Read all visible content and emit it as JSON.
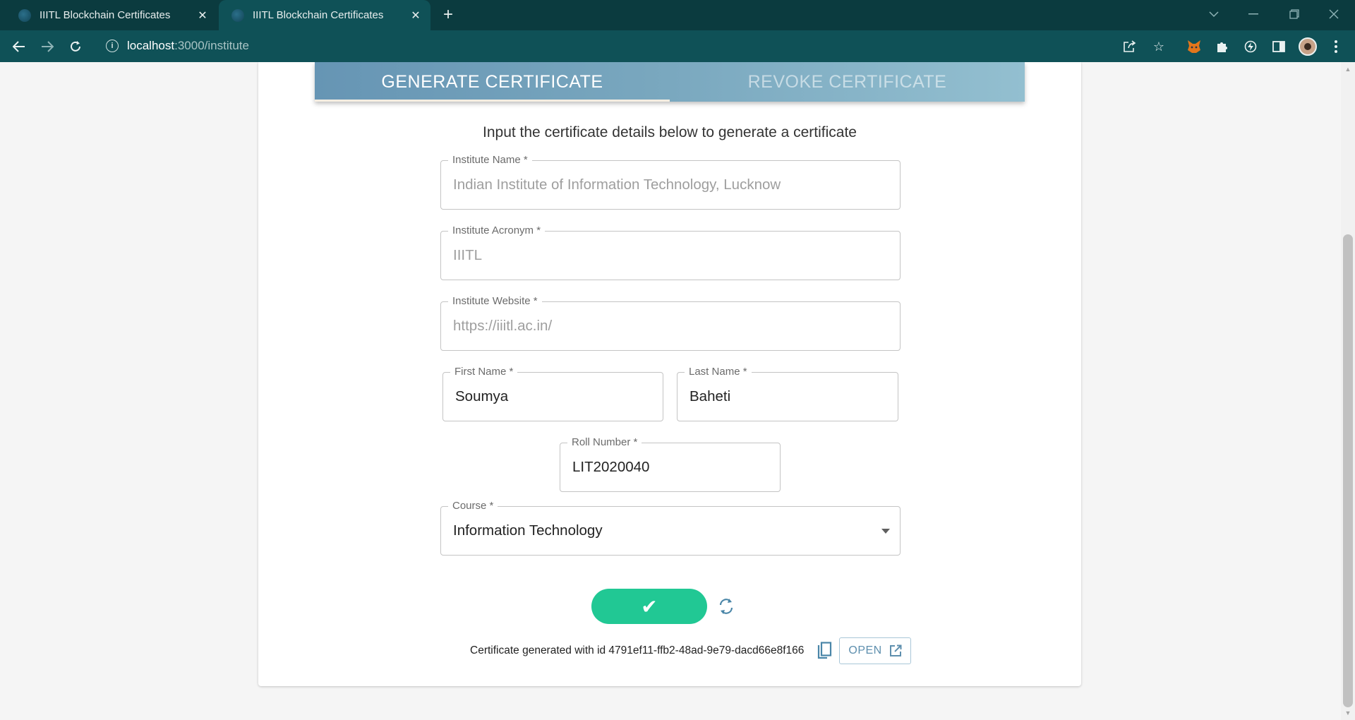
{
  "browser": {
    "tabs": [
      {
        "title": "IIITL Blockchain Certificates",
        "active": false
      },
      {
        "title": "IIITL Blockchain Certificates",
        "active": true
      }
    ],
    "url_host": "localhost",
    "url_path": ":3000/institute"
  },
  "page": {
    "tabs": {
      "generate": "GENERATE CERTIFICATE",
      "revoke": "REVOKE CERTIFICATE"
    },
    "subtitle": "Input the certificate details below to generate a certificate",
    "fields": {
      "institute_name": {
        "label": "Institute Name *",
        "value": "Indian Institute of Information Technology, Lucknow"
      },
      "institute_acronym": {
        "label": "Institute Acronym *",
        "value": "IIITL"
      },
      "institute_website": {
        "label": "Institute Website *",
        "value": "https://iiitl.ac.in/"
      },
      "first_name": {
        "label": "First Name *",
        "value": "Soumya"
      },
      "last_name": {
        "label": "Last Name *",
        "value": "Baheti"
      },
      "roll_number": {
        "label": "Roll Number *",
        "value": "LIT2020040"
      },
      "course": {
        "label": "Course *",
        "value": "Information Technology"
      }
    },
    "submit_label": "✔",
    "result": {
      "message": "Certificate generated with id 4791ef11-ffb2-48ad-9e79-dacd66e8f166",
      "open_label": "OPEN"
    }
  },
  "colors": {
    "browser_tabstrip": "#0b3b3f",
    "browser_toolbar": "#0f5157",
    "tab_gradient_start": "#6695b4",
    "tab_gradient_end": "#93bfd0",
    "submit_button": "#21c894",
    "open_button_text": "#5e8fae"
  }
}
